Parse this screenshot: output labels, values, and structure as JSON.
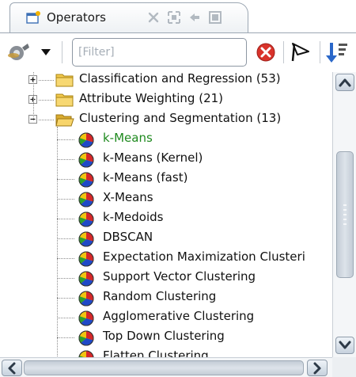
{
  "tab": {
    "label": "Operators"
  },
  "toolbar": {
    "filter_placeholder": "[Filter]"
  },
  "tree": {
    "groups": [
      {
        "label": "Classification and Regression (53)",
        "expanded": false
      },
      {
        "label": "Attribute Weighting (21)",
        "expanded": false
      },
      {
        "label": "Clustering and Segmentation (13)",
        "expanded": true
      }
    ],
    "operators": [
      {
        "label": "k-Means",
        "selected": true
      },
      {
        "label": "k-Means (Kernel)"
      },
      {
        "label": "k-Means (fast)"
      },
      {
        "label": "X-Means"
      },
      {
        "label": "k-Medoids"
      },
      {
        "label": "DBSCAN"
      },
      {
        "label": "Expectation Maximization Clusteri"
      },
      {
        "label": "Support Vector Clustering"
      },
      {
        "label": "Random Clustering"
      },
      {
        "label": "Agglomerative Clustering"
      },
      {
        "label": "Top Down Clustering"
      },
      {
        "label": "Flatten Clustering"
      }
    ]
  },
  "icons": {
    "tab": "new-window-icon",
    "tab_controls": [
      "close-tab-icon",
      "maximize-icon",
      "dock-icon",
      "restore-icon"
    ],
    "toolbar": [
      "operator-gear-icon",
      "dropdown-arrow-icon",
      "clear-filter-icon",
      "flag-icon",
      "sort-icon"
    ],
    "folder": "folder-icon",
    "operator": "clustering-operator-icon"
  },
  "colors": {
    "selected_text": "#1f8a1f",
    "clear_button": "#d9332b",
    "sort_button": "#2a67c9",
    "folder": "#f2c94c"
  }
}
